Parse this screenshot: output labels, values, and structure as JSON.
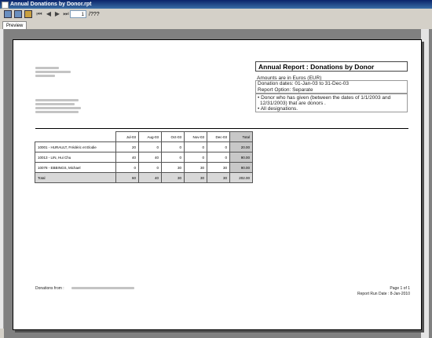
{
  "window": {
    "title": "Annual Donations by Donor.rpt"
  },
  "toolbar": {
    "page_current": "1",
    "page_total": "/???"
  },
  "tabs": [
    {
      "label": "Preview"
    }
  ],
  "report": {
    "heading": "Annual Report : Donations by Donor",
    "currency_note": "Amounts are in Euros (EUR)",
    "dates": "Donation dates: 01-Jan-03 to 31-Dec-03",
    "option": "Report Option: Separate",
    "criteria_line1": "• Donor who has given (between the dates of 1/1/2003 and",
    "criteria_line2": "12/31/2003) that are donors .",
    "criteria_line3": "• All designations."
  },
  "table": {
    "headers": [
      "",
      "Jul-03",
      "Aug-03",
      "Oct-03",
      "Nov-03",
      "Dec-03",
      "Total"
    ],
    "rows": [
      {
        "name": "10001 - HURAULT, Frédéric et Elodie",
        "values": [
          "20",
          "0",
          "0",
          "0",
          "0",
          "20.00"
        ]
      },
      {
        "name": "10013 - LIN, Hui Chu",
        "values": [
          "40",
          "40",
          "0",
          "0",
          "0",
          "90.00"
        ]
      },
      {
        "name": "10078 - EBBINGS, Michael",
        "values": [
          "0",
          "0",
          "30",
          "30",
          "30",
          "90.00"
        ]
      }
    ],
    "total": {
      "label": "Total",
      "values": [
        "60",
        "40",
        "30",
        "30",
        "30",
        "202.00"
      ]
    }
  },
  "footer": {
    "donations_from": "Donations from :",
    "page": "Page 1 of 1",
    "run_date": "Report Run Date : 8-Jan-2010"
  }
}
